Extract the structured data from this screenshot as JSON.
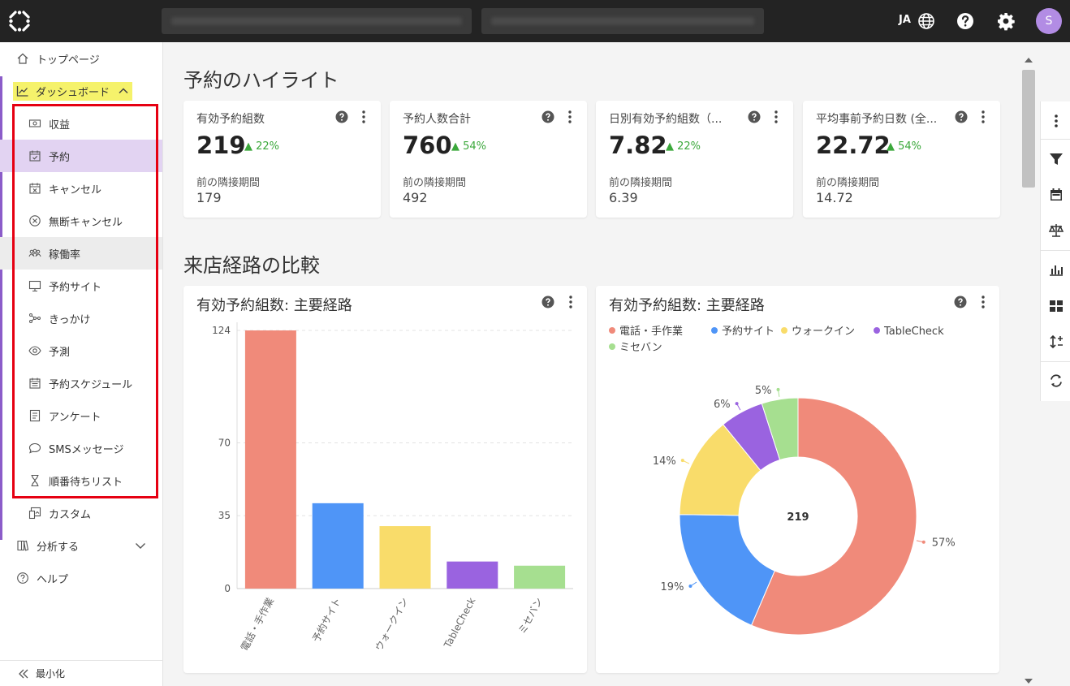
{
  "topbar": {
    "lang": "JA",
    "avatar_initial": "S"
  },
  "sidebar": {
    "top_page": "トップページ",
    "dashboard": "ダッシュボード",
    "items": [
      {
        "label": "収益",
        "icon": "revenue-icon"
      },
      {
        "label": "予約",
        "icon": "calendar-check-icon"
      },
      {
        "label": "キャンセル",
        "icon": "calendar-x-icon"
      },
      {
        "label": "無断キャンセル",
        "icon": "circle-x-icon"
      },
      {
        "label": "稼働率",
        "icon": "people-icon"
      },
      {
        "label": "予約サイト",
        "icon": "monitor-icon"
      },
      {
        "label": "きっかけ",
        "icon": "network-icon"
      },
      {
        "label": "予測",
        "icon": "eye-icon"
      },
      {
        "label": "予約スケジュール",
        "icon": "calendar-icon"
      },
      {
        "label": "アンケート",
        "icon": "survey-icon"
      },
      {
        "label": "SMSメッセージ",
        "icon": "chat-bubble-icon"
      },
      {
        "label": "順番待ちリスト",
        "icon": "hourglass-icon"
      }
    ],
    "custom": "カスタム",
    "analyze": "分析する",
    "help": "ヘルプ",
    "minimize": "最小化"
  },
  "highlights": {
    "title": "予約のハイライト",
    "prev_label": "前の隣接期間",
    "cards": [
      {
        "title": "有効予約組数",
        "value": "219",
        "delta": "22%",
        "prev": "179"
      },
      {
        "title": "予約人数合計",
        "value": "760",
        "delta": "54%",
        "prev": "492"
      },
      {
        "title": "日別有効予約組数（...",
        "value": "7.82",
        "delta": "22%",
        "prev": "6.39"
      },
      {
        "title": "平均事前予約日数 (全...",
        "value": "22.72",
        "delta": "54%",
        "prev": "14.72"
      }
    ]
  },
  "comparison": {
    "title": "来店経路の比較"
  },
  "chart_data": [
    {
      "type": "bar",
      "title": "有効予約組数: 主要経路",
      "categories": [
        "電話・手作業",
        "予約サイト",
        "ウォークイン",
        "TableCheck",
        "ミセバン"
      ],
      "values": [
        124,
        41,
        30,
        13,
        11
      ],
      "colors": [
        "#f08a7a",
        "#4f95f7",
        "#f9dc6a",
        "#9a63e0",
        "#a6df90"
      ],
      "y_ticks": [
        0,
        35,
        70,
        124
      ],
      "ylim": [
        0,
        124
      ],
      "grid": true
    },
    {
      "type": "pie",
      "title": "有効予約組数: 主要経路",
      "center_label": "219",
      "categories": [
        "電話・手作業",
        "予約サイト",
        "ウォークイン",
        "TableCheck",
        "ミセバン"
      ],
      "percents": [
        57,
        19,
        14,
        6,
        5
      ],
      "labels": [
        "57%",
        "19%",
        "14%",
        "6%",
        "5%"
      ],
      "colors": [
        "#f08a7a",
        "#4f95f7",
        "#f9dc6a",
        "#9a63e0",
        "#a6df90"
      ],
      "legend_placement": "top-left"
    }
  ]
}
